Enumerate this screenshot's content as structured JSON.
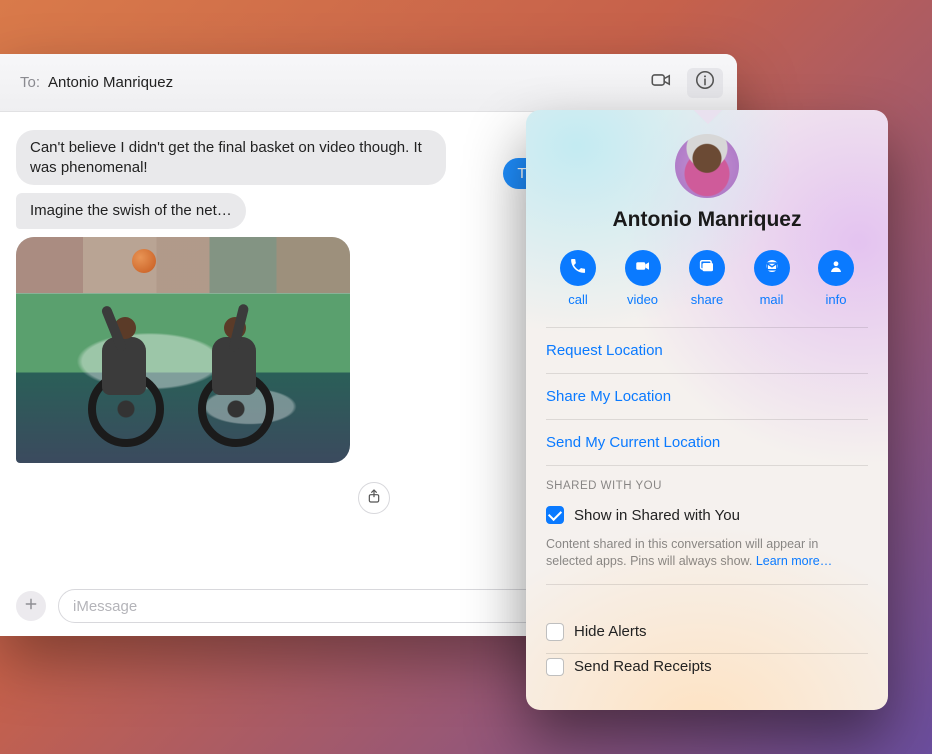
{
  "header": {
    "to_label": "To:",
    "to_name": "Antonio Manriquez",
    "icons": {
      "facetime": "video-camera-icon",
      "info": "info-circle-icon"
    }
  },
  "messages": {
    "sent": [
      {
        "text": "Thanks for the game earlier!"
      }
    ],
    "received": [
      {
        "text": "Can't believe I didn't get the final basket on video though. It was phenomenal!"
      },
      {
        "text": "Imagine the swish of the net…"
      }
    ],
    "image_attachment": {
      "alt": "Two people playing wheelchair basketball on an outdoor court"
    },
    "share_icon": "share-up-icon"
  },
  "compose": {
    "placeholder": "iMessage",
    "value": "",
    "add_icon": "plus-icon"
  },
  "popover": {
    "contact_name": "Antonio Manriquez",
    "actions": [
      {
        "id": "call",
        "label": "call"
      },
      {
        "id": "video",
        "label": "video"
      },
      {
        "id": "share",
        "label": "share"
      },
      {
        "id": "mail",
        "label": "mail"
      },
      {
        "id": "info",
        "label": "info"
      }
    ],
    "links": {
      "request_location": "Request Location",
      "share_my_location": "Share My Location",
      "send_current_location": "Send My Current Location"
    },
    "shared_with_you": {
      "section_label": "SHARED WITH YOU",
      "checkbox_label": "Show in Shared with You",
      "checked": true,
      "help_text_a": "Content shared in this conversation will appear in selected apps. Pins will always show. ",
      "help_text_link": "Learn more…"
    },
    "hide_alerts": {
      "label": "Hide Alerts",
      "checked": false
    },
    "send_read_receipts": {
      "label": "Send Read Receipts",
      "checked": false
    }
  }
}
